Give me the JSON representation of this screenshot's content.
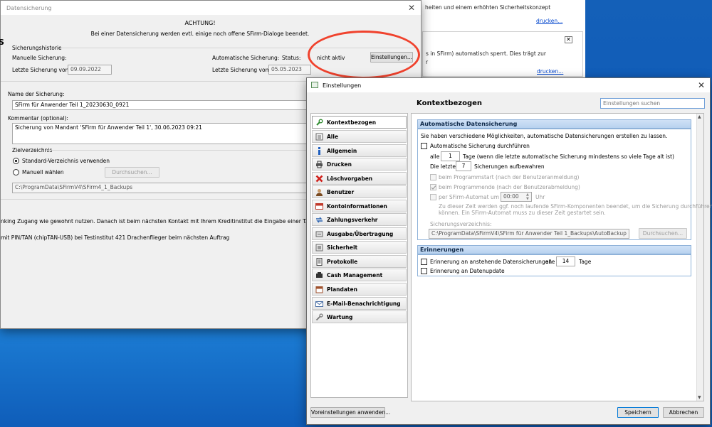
{
  "background_window": {
    "text_line1": "heiten und einem erhöhten Sicherheitskonzept",
    "link1": "drucken...",
    "text_line2": "s in SFirm) automatisch sperrt. Dies trägt zur",
    "text_line3": "r",
    "link2": "drucken...",
    "close_glyph": "✕"
  },
  "datensicherung": {
    "title": "Datensicherung",
    "close": "✕",
    "warning_title": "ACHTUNG!",
    "warning_text": "Bei einer Datensicherung werden evtl. einige noch offene SFirm-Dialoge beendet.",
    "historie_label": "Sicherungshistorie",
    "manuelle_label": "Manuelle Sicherung:",
    "letzte_manuell_label": "Letzte Sicherung vom:",
    "letzte_manuell_value": "09.09.2022",
    "automatische_label": "Automatische Sicherung:",
    "status_label": "Status:",
    "status_value": "nicht aktiv",
    "einstellungen_button": "Einstellungen...",
    "letzte_auto_label": "Letzte Sicherung vom:",
    "letzte_auto_value": "05.05.2023",
    "name_label": "Name der Sicherung:",
    "name_value": "SFirm für Anwender Teil 1_20230630_0921",
    "kommentar_label": "Kommentar (optional):",
    "kommentar_value": "Sicherung von Mandant 'SFirm für Anwender Teil 1', 30.06.2023 09:21",
    "zielverzeichnis_label": "Zielverzeichnis",
    "standard_radio": "Standard-Verzeichnis verwenden",
    "manuell_radio": "Manuell wählen",
    "durchsuchen_button": "Durchsuchen...",
    "path_value": "C:\\ProgramData\\SFirmV4\\SFirm4_1_Backups",
    "overflow_line1": "nking Zugang wie gewohnt nutzen. Danach ist beim nächsten Kontakt mit Ihrem Kreditinstitut die Eingabe einer TAN zwingend erforder",
    "overflow_line2": "mit PIN/TAN (chipTAN-USB) bei Testinstitut 421 Drachenflieger beim nächsten Auftrag",
    "overflow_char": "S"
  },
  "einstellungen": {
    "title": "Einstellungen",
    "close": "✕",
    "page_heading": "Kontextbezogen",
    "search_placeholder": "Einstellungen suchen",
    "nav_items": [
      {
        "label": "Kontextbezogen",
        "icon": "wrench-icon",
        "color": "#2e8b2e"
      },
      {
        "label": "Alle",
        "icon": "list-icon",
        "color": "#555555"
      },
      {
        "label": "Allgemein",
        "icon": "info-icon",
        "color": "#1f5fbf"
      },
      {
        "label": "Drucken",
        "icon": "printer-icon",
        "color": "#3a3a3a"
      },
      {
        "label": "Löschvorgaben",
        "icon": "delete-x-icon",
        "color": "#d0201b"
      },
      {
        "label": "Benutzer",
        "icon": "user-icon",
        "color": "#7a4a20"
      },
      {
        "label": "Kontoinformationen",
        "icon": "account-icon",
        "color": "#c0392b"
      },
      {
        "label": "Zahlungsverkehr",
        "icon": "payment-icon",
        "color": "#2a62b0"
      },
      {
        "label": "Ausgabe/Übertragung",
        "icon": "transfer-icon",
        "color": "#6a6a6a"
      },
      {
        "label": "Sicherheit",
        "icon": "security-icon",
        "color": "#6d6d6d"
      },
      {
        "label": "Protokolle",
        "icon": "log-icon",
        "color": "#4a4a4a"
      },
      {
        "label": "Cash Management",
        "icon": "cash-icon",
        "color": "#333333"
      },
      {
        "label": "Plandaten",
        "icon": "calendar-icon",
        "color": "#a0522d"
      },
      {
        "label": "E-Mail-Benachrichtigung",
        "icon": "mail-icon",
        "color": "#4a6fa5"
      },
      {
        "label": "Wartung",
        "icon": "tools-icon",
        "color": "#777777"
      }
    ],
    "auto": {
      "header": "Automatische Datensicherung",
      "intro": "Sie haben verschiedene Möglichkeiten, automatische Datensicherungen erstellen zu lassen.",
      "enable_label": "Automatische Sicherung durchführen",
      "alle_label": "alle",
      "alle_value": "1",
      "tage_text": "Tage (wenn die letzte automatische Sicherung mindestens so viele Tage alt ist)",
      "die_letzten_label": "Die letzten",
      "die_letzten_value": "7",
      "aufbewahren_text": "Sicherungen aufbewahren",
      "programmstart_label": "beim Programmstart (nach der Benutzeranmeldung)",
      "programmende_label": "beim Programmende (nach der Benutzerabmeldung)",
      "automat_label": "per SFirm-Automat",
      "um_label": "um",
      "time_value": "00:00",
      "uhr_label": "Uhr",
      "hint_line1": "Zu dieser Zeit werden ggf. noch laufende SFirm-Komponenten beendet, um die Sicherung durchführen zu",
      "hint_line2": "können. Ein SFirm-Automat muss zu dieser Zeit gestartet sein.",
      "verzeichnis_label": "Sicherungsverzeichnis:",
      "verzeichnis_value": "C:\\ProgramData\\SFirmV4\\SFirm für Anwender Teil 1_Backups\\AutoBackup",
      "durchsuchen_button": "Durchsuchen..."
    },
    "erinnerungen": {
      "header": "Erinnerungen",
      "anstehend_label": "Erinnerung an anstehende Datensicherungen",
      "alle_label": "alle",
      "alle_value": "14",
      "tage_label": "Tage",
      "datenupdate_label": "Erinnerung an Datenupdate"
    },
    "footer": {
      "voreinstellungen_button": "Voreinstellungen anwenden...",
      "speichern_button": "Speichern",
      "abbrechen_button": "Abbrechen"
    }
  }
}
